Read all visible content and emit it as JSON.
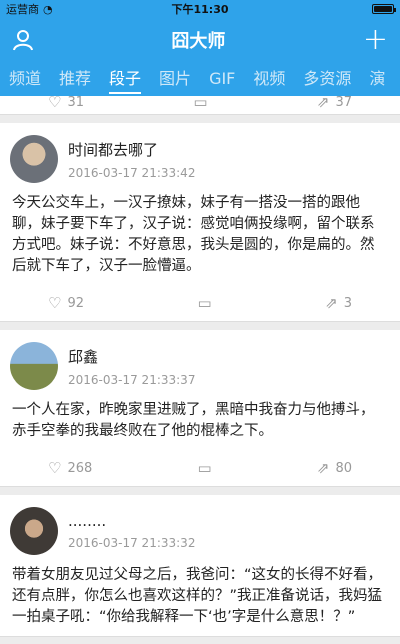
{
  "status": {
    "carrier": "运营商",
    "time": "下午11:30"
  },
  "nav": {
    "title": "囧大师"
  },
  "tabs": [
    "频道",
    "推荐",
    "段子",
    "图片",
    "GIF",
    "视频",
    "多资源",
    "演"
  ],
  "active_tab": "段子",
  "top_actions": {
    "likes": "31",
    "shares": "37"
  },
  "posts": [
    {
      "name": "时间都去哪了",
      "time": "2016-03-17 21:33:42",
      "text": "今天公交车上，一汉子撩妹，妹子有一搭没一搭的跟他聊，妹子要下车了，汉子说：感觉咱俩投缘啊，留个联系方式吧。妹子说：不好意思，我头是圆的，你是扁的。然后就下车了，汉子一脸懵逼。",
      "likes": "92",
      "shares": "3"
    },
    {
      "name": "邱鑫",
      "time": "2016-03-17 21:33:37",
      "text": "一个人在家，昨晚家里进贼了，黑暗中我奋力与他搏斗，赤手空拳的我最终败在了他的棍棒之下。",
      "likes": "268",
      "shares": "80"
    },
    {
      "name": "........",
      "time": "2016-03-17 21:33:32",
      "text": "带着女朋友见过父母之后，我爸问：“这女的长得不好看，还有点胖，你怎么也喜欢这样的？”我正准备说话，我妈猛一拍桌子吼：“你给我解释一下‘也’字是什么意思！？”",
      "likes": "",
      "shares": ""
    }
  ],
  "icons": {
    "user": "user-icon",
    "plus": "plus-icon",
    "like": "heart-icon",
    "comment": "comment-icon",
    "share": "share-icon"
  }
}
